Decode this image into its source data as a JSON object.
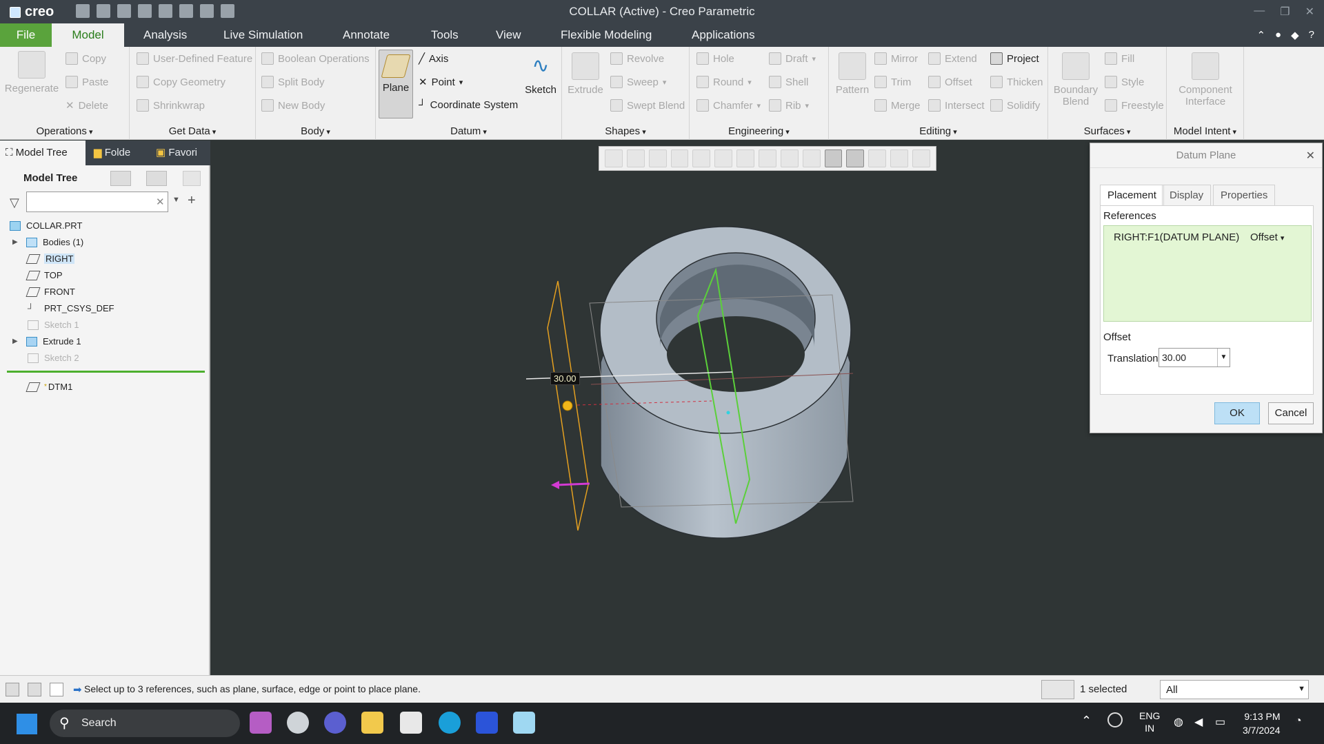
{
  "window": {
    "title": "COLLAR (Active) - Creo Parametric",
    "app_logo": "creo"
  },
  "menu": {
    "file": "File",
    "tabs": [
      "Model",
      "Analysis",
      "Live Simulation",
      "Annotate",
      "Tools",
      "View",
      "Flexible Modeling",
      "Applications"
    ]
  },
  "ribbon": {
    "operations": {
      "label": "Operations",
      "regenerate": "Regenerate",
      "copy": "Copy",
      "paste": "Paste",
      "delete": "Delete"
    },
    "get_data": {
      "label": "Get Data",
      "udf": "User-Defined Feature",
      "copy_geometry": "Copy Geometry",
      "shrinkwrap": "Shrinkwrap"
    },
    "body": {
      "label": "Body",
      "boolean": "Boolean Operations",
      "split": "Split Body",
      "new": "New Body"
    },
    "datum": {
      "label": "Datum",
      "plane": "Plane",
      "axis": "Axis",
      "point": "Point",
      "csys": "Coordinate System",
      "sketch": "Sketch"
    },
    "shapes": {
      "label": "Shapes",
      "extrude": "Extrude",
      "revolve": "Revolve",
      "sweep": "Sweep",
      "swept_blend": "Swept Blend"
    },
    "engineering": {
      "label": "Engineering",
      "hole": "Hole",
      "round": "Round",
      "chamfer": "Chamfer",
      "draft": "Draft",
      "shell": "Shell",
      "rib": "Rib"
    },
    "editing": {
      "label": "Editing",
      "pattern": "Pattern",
      "mirror": "Mirror",
      "trim": "Trim",
      "merge": "Merge",
      "extend": "Extend",
      "offset": "Offset",
      "intersect": "Intersect",
      "project": "Project",
      "thicken": "Thicken",
      "solidify": "Solidify"
    },
    "surfaces": {
      "label": "Surfaces",
      "boundary": "Boundary",
      "blend": "Blend",
      "fill": "Fill",
      "style": "Style",
      "freestyle": "Freestyle"
    },
    "model_intent": {
      "label": "Model Intent",
      "component": "Component",
      "interface": "Interface"
    }
  },
  "left_panel": {
    "tabs": [
      "Model Tree",
      "Folde",
      "Favori"
    ],
    "header": "Model Tree",
    "search_placeholder": "",
    "items": [
      {
        "label": "COLLAR.PRT"
      },
      {
        "label": "Bodies (1)"
      },
      {
        "label": "RIGHT"
      },
      {
        "label": "TOP"
      },
      {
        "label": "FRONT"
      },
      {
        "label": "PRT_CSYS_DEF"
      },
      {
        "label": "Sketch 1"
      },
      {
        "label": "Extrude 1"
      },
      {
        "label": "Sketch 2"
      },
      {
        "label": "DTM1"
      }
    ],
    "new_marker": "*"
  },
  "viewport": {
    "dimension_value": "30.00"
  },
  "dialog": {
    "title": "Datum Plane",
    "tabs": [
      "Placement",
      "Display",
      "Properties"
    ],
    "references_label": "References",
    "reference": "RIGHT:F1(DATUM PLANE)",
    "constraint": "Offset",
    "offset_label": "Offset",
    "translation_label": "Translation",
    "translation_value": "30.00",
    "ok": "OK",
    "cancel": "Cancel"
  },
  "status": {
    "message": "Select up to 3 references, such as plane, surface, edge or point to place plane.",
    "selected": "1 selected",
    "filter": "All"
  },
  "taskbar": {
    "search": "Search",
    "lang_top": "ENG",
    "lang_bottom": "IN",
    "time": "9:13 PM",
    "date": "3/7/2024"
  }
}
